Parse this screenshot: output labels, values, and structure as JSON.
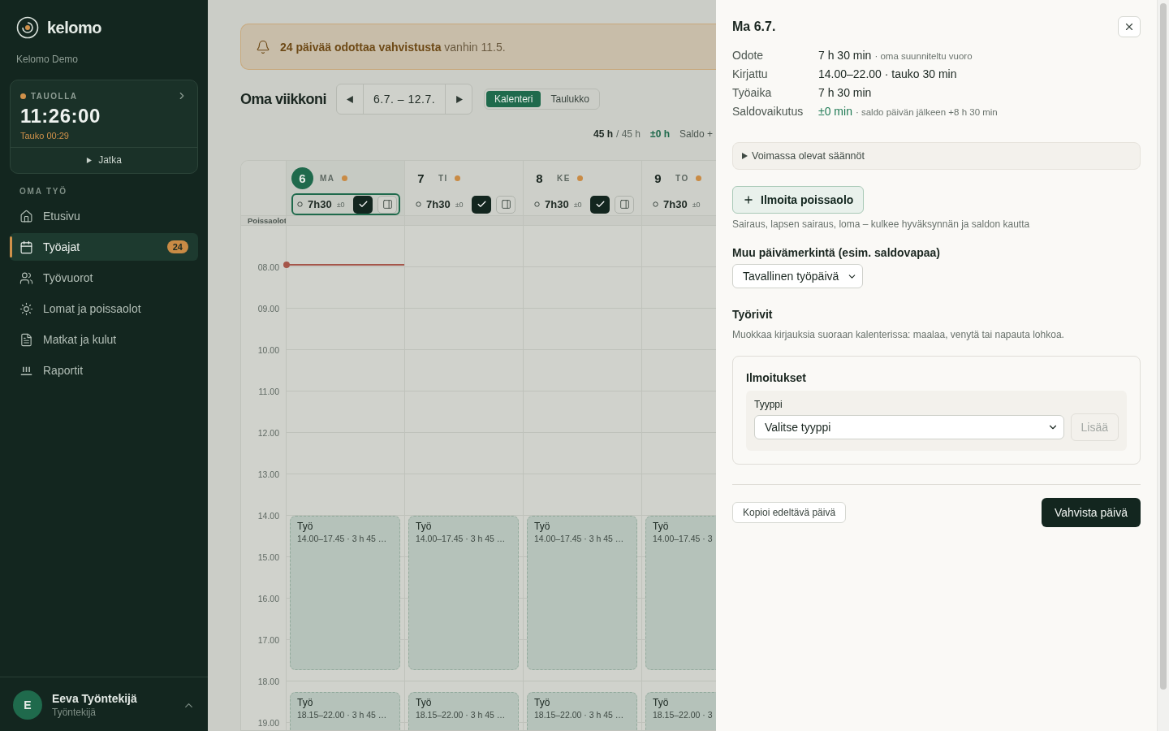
{
  "sidebar": {
    "brand": "kelomo",
    "org": "Kelomo Demo",
    "timer": {
      "status": "TAUOLLA",
      "time": "11:26:00",
      "break": "Tauko 00:29",
      "action": "Jatka"
    },
    "section": "OMA TYÖ",
    "items": [
      {
        "kind": "home",
        "label": "Etusivu",
        "selected": false
      },
      {
        "kind": "calendar",
        "label": "Työajat",
        "selected": true,
        "badge": "24"
      },
      {
        "kind": "people",
        "label": "Työvuorot",
        "selected": false
      },
      {
        "kind": "sun",
        "label": "Lomat ja poissaolot",
        "selected": false
      },
      {
        "kind": "receipt",
        "label": "Matkat ja kulut",
        "selected": false
      },
      {
        "kind": "chart",
        "label": "Raportit",
        "selected": false
      }
    ],
    "user": {
      "initial": "E",
      "name": "Eeva Työntekijä",
      "role": "Työntekijä"
    }
  },
  "banner": {
    "text": "**24 päivää odottaa vahvistusta** vanhin 11.5."
  },
  "week": {
    "title": "Oma viikkoni",
    "range": "6.7. – 12.7.",
    "views": [
      {
        "label": "Kalenteri",
        "selected": true
      },
      {
        "label": "Taulukko",
        "selected": false
      }
    ],
    "totals": {
      "done": "45 h",
      "target": "/ 45 h",
      "diff": "±0 h",
      "saldo": "Saldo +"
    }
  },
  "calendar": {
    "absence_label": "Poissaolot",
    "hours": [
      "08.00",
      "09.00",
      "10.00",
      "11.00",
      "12.00",
      "13.00",
      "14.00",
      "15.00",
      "16.00",
      "17.00",
      "18.00",
      "19.00"
    ],
    "days": [
      {
        "number": "6",
        "weekday": "MA",
        "today": true,
        "selected": true,
        "hours": "7h30",
        "diff": "±0",
        "actions": true,
        "events": [
          {
            "title": "Työ",
            "detail": "14.00–17.45 · 3 h 45 …"
          },
          {
            "title": "Työ",
            "detail": "18.15–22.00 · 3 h 45 …"
          }
        ]
      },
      {
        "number": "7",
        "weekday": "TI",
        "today": false,
        "selected": false,
        "hours": "7h30",
        "diff": "±0",
        "actions": true,
        "events": [
          {
            "title": "Työ",
            "detail": "14.00–17.45 · 3 h 45 …"
          },
          {
            "title": "Työ",
            "detail": "18.15–22.00 · 3 h 45 …"
          }
        ]
      },
      {
        "number": "8",
        "weekday": "KE",
        "today": false,
        "selected": false,
        "hours": "7h30",
        "diff": "±0",
        "actions": true,
        "events": [
          {
            "title": "Työ",
            "detail": "14.00–17.45 · 3 h 45 …"
          },
          {
            "title": "Työ",
            "detail": "18.15–22.00 · 3 h 45 …"
          }
        ]
      },
      {
        "number": "9",
        "weekday": "TO",
        "today": false,
        "selected": false,
        "hours": "7h30",
        "diff": "±0",
        "actions": false,
        "events": [
          {
            "title": "Työ",
            "detail": "14.00–17.45 · 3"
          },
          {
            "title": "Työ",
            "detail": "18.15–22.00 · 3"
          }
        ]
      }
    ]
  },
  "drawer": {
    "title": "Ma 6.7.",
    "rows": [
      {
        "kind": "plain",
        "label": "Odote",
        "value": "7 h 30 min",
        "note": "· oma suunniteltu vuoro"
      },
      {
        "kind": "plain",
        "label": "Kirjattu",
        "value": "14.00–22.00 · tauko 30 min"
      },
      {
        "kind": "plain",
        "label": "Työaika",
        "value": "7 h 30 min"
      },
      {
        "kind": "positive",
        "label": "Saldovaikutus",
        "value": "±0 min",
        "note": "· saldo päivän jälkeen +8 h 30 min"
      }
    ],
    "rules": {
      "label": "Voimassa olevat säännöt",
      "expanded": false
    },
    "absence_button": "Ilmoita poissaolo",
    "absence_hint": "Sairaus, lapsen sairaus, loma – kulkee hyväksynnän ja saldon kautta",
    "day_mark": {
      "label": "Muu päivämerkintä (esim. saldovapaa)",
      "value": "Tavallinen työpäivä"
    },
    "work_rows": {
      "title": "Työrivit",
      "hint": "Muokkaa kirjauksia suoraan kalenterissa: maalaa, venytä tai napauta lohkoa."
    },
    "notices": {
      "title": "Ilmoitukset",
      "type_label": "Tyyppi",
      "type_value": "Valitse tyyppi",
      "add": "Lisää",
      "add_disabled": true
    },
    "copy_button": "Kopioi edeltävä päivä",
    "confirm_button": "Vahvista päivä"
  }
}
